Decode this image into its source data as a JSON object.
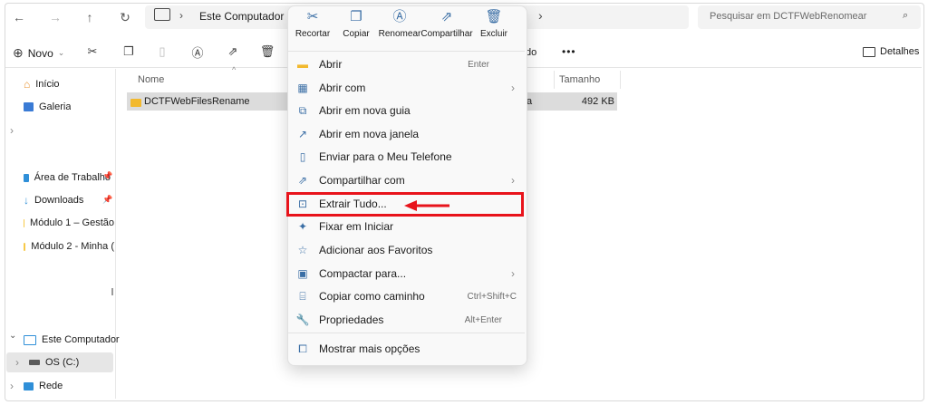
{
  "address": {
    "location": "Este Computador",
    "search_placeholder": "Pesquisar em DCTFWebRenomear"
  },
  "toolbar": {
    "new_label": "Novo",
    "more_label": "•••",
    "details_label": "Detalhes",
    "partial_label": "do"
  },
  "sidebar": {
    "home": "Início",
    "gallery": "Galeria",
    "desktop": "Área de Trabalho",
    "downloads": "Downloads",
    "module1": "Módulo 1 – Gestão",
    "module2": "Módulo 2 - Minha (",
    "this_pc": "Este Computador",
    "os_c": "OS (C:)",
    "network": "Rede"
  },
  "columns": {
    "name": "Nome",
    "size": "Tamanho"
  },
  "file": {
    "name": "DCTFWebFilesRename",
    "type_fragment": "a",
    "size": "492 KB"
  },
  "context_menu": {
    "top_actions": [
      {
        "label": "Recortar",
        "icon": "scissors-icon"
      },
      {
        "label": "Copiar",
        "icon": "copy-icon"
      },
      {
        "label": "Renomear",
        "icon": "rename-icon"
      },
      {
        "label": "Compartilhar",
        "icon": "share-icon"
      },
      {
        "label": "Excluir",
        "icon": "trash-icon"
      }
    ],
    "items": [
      {
        "label": "Abrir",
        "shortcut": "Enter"
      },
      {
        "label": "Abrir com",
        "shortcut": ""
      },
      {
        "label": "Abrir em nova guia",
        "shortcut": ""
      },
      {
        "label": "Abrir em nova janela",
        "shortcut": ""
      },
      {
        "label": "Enviar para o Meu Telefone",
        "shortcut": ""
      },
      {
        "label": "Compartilhar com",
        "shortcut": ""
      },
      {
        "label": "Extrair Tudo...",
        "shortcut": ""
      },
      {
        "label": "Fixar em Iniciar",
        "shortcut": ""
      },
      {
        "label": "Adicionar aos Favoritos",
        "shortcut": ""
      },
      {
        "label": "Compactar para...",
        "shortcut": ""
      },
      {
        "label": "Copiar como caminho",
        "shortcut": "Ctrl+Shift+C"
      },
      {
        "label": "Propriedades",
        "shortcut": "Alt+Enter"
      },
      {
        "label": "Mostrar mais opções",
        "shortcut": ""
      }
    ]
  },
  "colors": {
    "highlight": "#e8131b",
    "folder": "#f7c948",
    "accent": "#3a6ea5"
  }
}
